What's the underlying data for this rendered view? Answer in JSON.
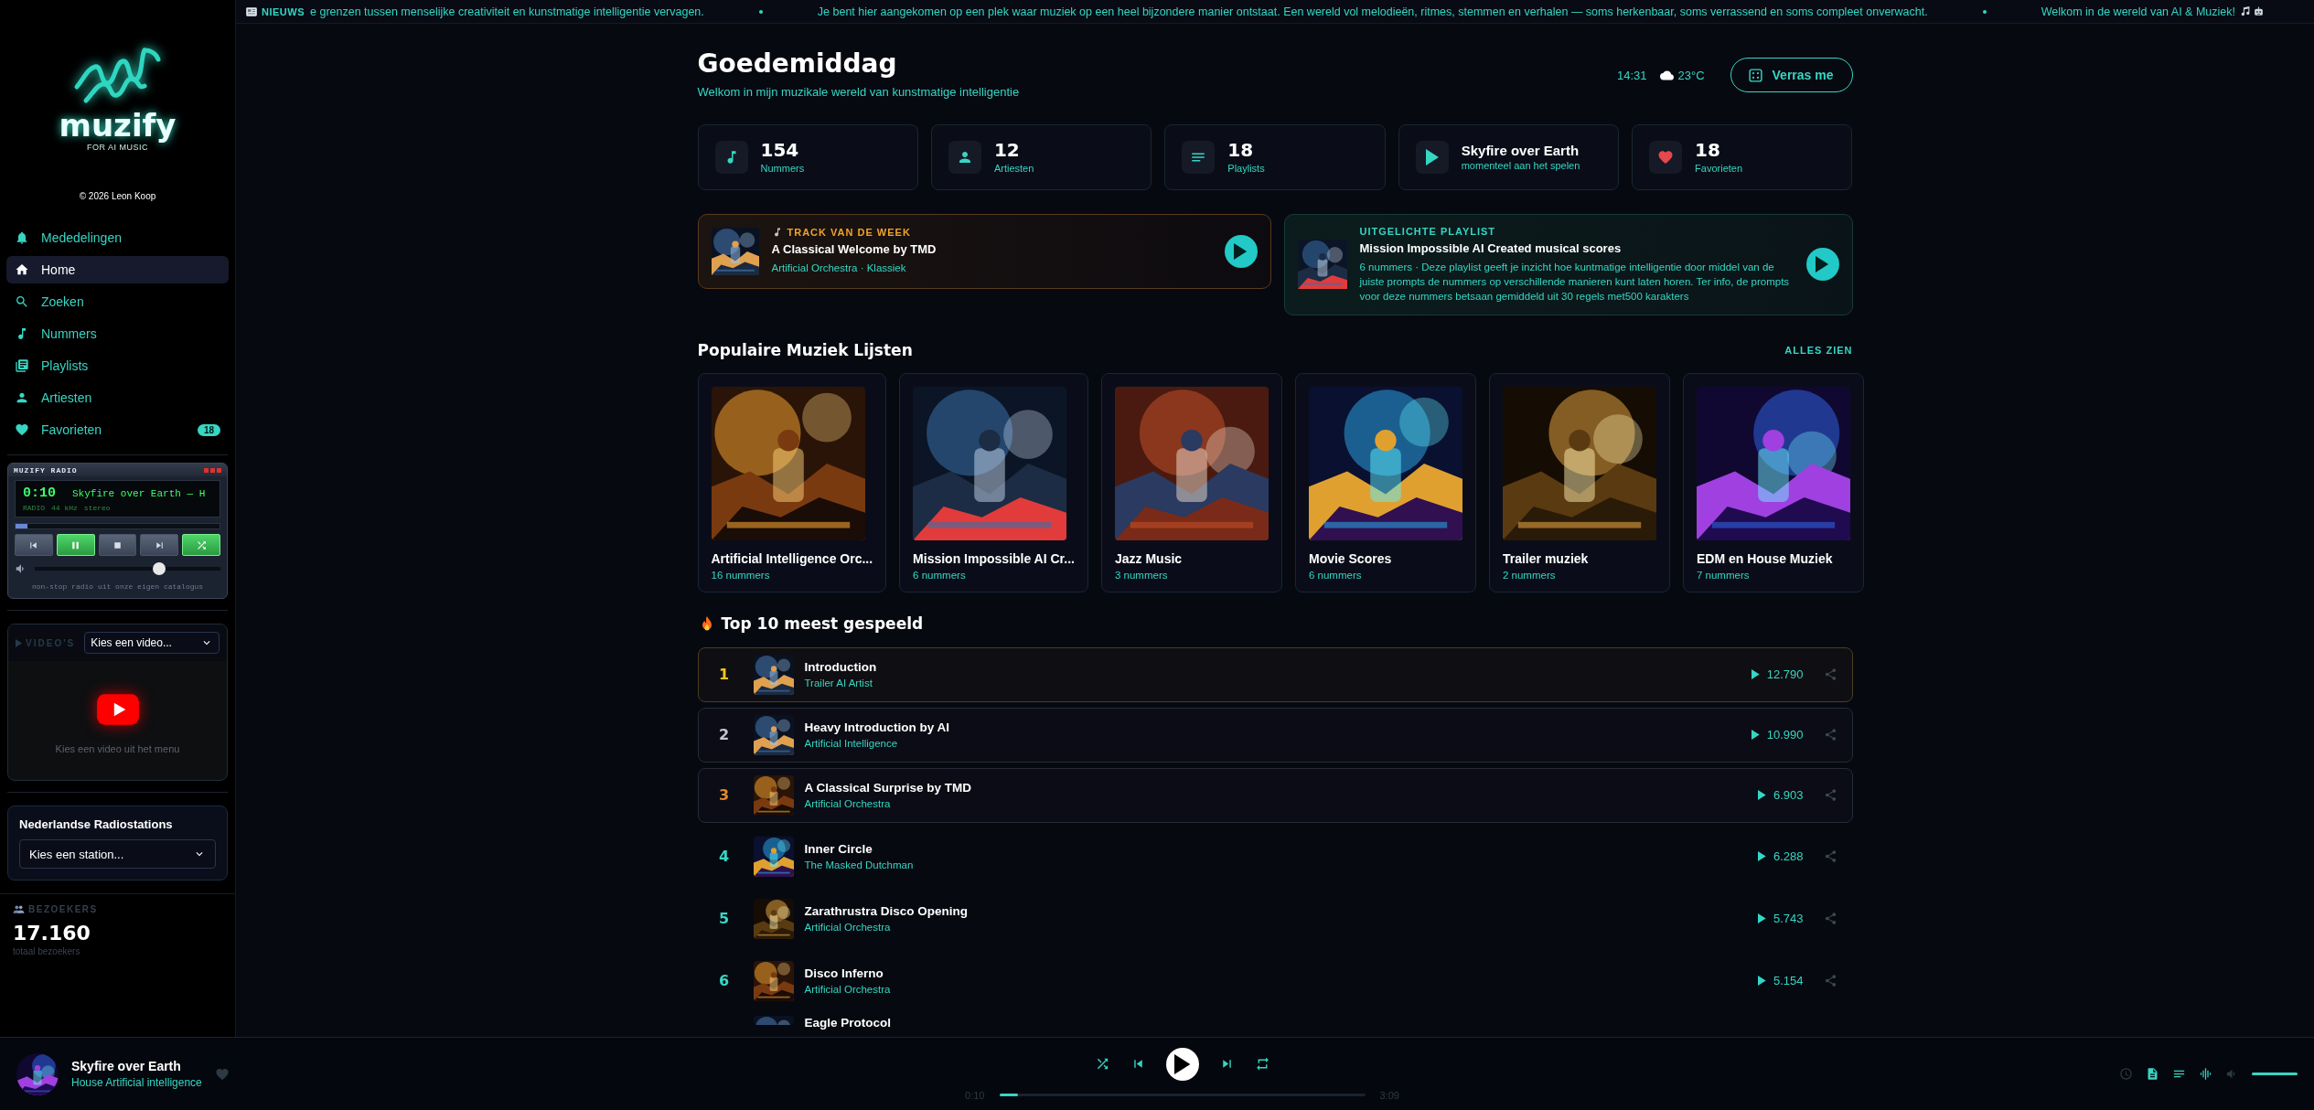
{
  "sidebar": {
    "logo": {
      "name": "muzify",
      "tagline": "FOR AI MUSIC"
    },
    "copyright": "© 2026 Leon Koop",
    "nav": [
      {
        "label": "Mededelingen",
        "kind": "bell",
        "selected": false
      },
      {
        "label": "Home",
        "kind": "home",
        "selected": true
      },
      {
        "label": "Zoeken",
        "kind": "search",
        "selected": false
      },
      {
        "label": "Nummers",
        "kind": "note",
        "selected": false
      },
      {
        "label": "Playlists",
        "kind": "library",
        "selected": false
      },
      {
        "label": "Artiesten",
        "kind": "person",
        "selected": false
      },
      {
        "label": "Favorieten",
        "kind": "heart",
        "selected": false,
        "badge": "18"
      }
    ],
    "radio": {
      "title": "MUZIFY RADIO",
      "time": "0:10",
      "track": "Skyfire over Earth — H",
      "info": [
        "RADIO",
        "44 kHz",
        "stereo"
      ],
      "level": 0.06,
      "buttons": [
        {
          "kind": "prev",
          "on": false
        },
        {
          "kind": "pause",
          "on": true
        },
        {
          "kind": "stop",
          "on": false
        },
        {
          "kind": "next",
          "on": false
        },
        {
          "kind": "shuffle",
          "on": true
        }
      ],
      "volume": {
        "level": 0.68
      },
      "caption": "non-stop radio uit onze eigen catalogus"
    },
    "videos": {
      "label": "VIDEO'S",
      "select": "Kies een video...",
      "hint": "Kies een video uit het menu"
    },
    "stations": {
      "title": "Nederlandse Radiostations",
      "select": "Kies een station..."
    },
    "visitors": {
      "label": "BEZOEKERS",
      "count": "17.160",
      "caption": "totaal bezoekers"
    }
  },
  "ticker": {
    "label": "NIEUWS",
    "items": [
      "e grenzen tussen menselijke creativiteit en kunstmatige intelligentie vervagen.",
      "Je bent hier aangekomen op een plek waar muziek op een heel bijzondere manier ontstaat. Een wereld vol melodieën, ritmes, stemmen en verhalen — soms herkenbaar, soms verrassend en soms compleet onverwacht.",
      "Welkom in de wereld van AI & Muziek!"
    ]
  },
  "header": {
    "title": "Goedemiddag",
    "subtitle": "Welkom in mijn muzikale wereld van kunstmatige intelligentie",
    "time": "14:31",
    "weather": "23°C",
    "button": "Verras me"
  },
  "stats": [
    {
      "kind": "note",
      "value": "154",
      "label": "Nummers"
    },
    {
      "kind": "person",
      "value": "12",
      "label": "Artiesten"
    },
    {
      "kind": "list",
      "value": "18",
      "label": "Playlists"
    },
    {
      "kind": "play",
      "value": "Skyfire over Earth",
      "label": "momenteel aan het spelen"
    },
    {
      "kind": "heart",
      "value": "18",
      "label": "Favorieten"
    }
  ],
  "featured": [
    {
      "kind": "track",
      "label": "TRACK VAN DE WEEK",
      "title": "A Classical Welcome by TMD",
      "subtitle": "Artificial Orchestra · Klassiek"
    },
    {
      "kind": "playlist",
      "label": "UITGELICHTE PLAYLIST",
      "title": "Mission Impossible AI Created musical scores",
      "subtitle": "6 nummers · Deze playlist geeft je inzicht hoe kuntmatige intelligentie door middel van de juiste prompts de nummers op verschillende manieren kunt laten horen. Ter info, de prompts voor deze nummers betsaan gemiddeld uit 30 regels met500 karakters"
    }
  ],
  "playlists": {
    "title": "Populaire Muziek Lijsten",
    "link": "ALLES ZIEN",
    "items": [
      {
        "name": "Artificial Intelligence Orc...",
        "count": "16 nummers"
      },
      {
        "name": "Mission Impossible AI Cr...",
        "count": "6 nummers"
      },
      {
        "name": "Jazz Music",
        "count": "3 nummers"
      },
      {
        "name": "Movie Scores",
        "count": "6 nummers"
      },
      {
        "name": "Trailer muziek",
        "count": "2 nummers"
      },
      {
        "name": "EDM en House Muziek",
        "count": "7 nummers"
      }
    ]
  },
  "top": {
    "title": "Top 10 meest gespeeld",
    "rows": [
      {
        "rank": "1",
        "kind": "gold",
        "title": "Introduction",
        "artist": "Trailer AI Artist",
        "plays": "12.790"
      },
      {
        "rank": "2",
        "kind": "silver",
        "title": "Heavy Introduction by AI",
        "artist": "Artificial Intelligence",
        "plays": "10.990"
      },
      {
        "rank": "3",
        "kind": "bronze",
        "title": "A Classical Surprise by TMD",
        "artist": "Artificial Orchestra",
        "plays": "6.903"
      },
      {
        "rank": "4",
        "kind": "normal",
        "title": "Inner Circle",
        "artist": "The Masked Dutchman",
        "plays": "6.288"
      },
      {
        "rank": "5",
        "kind": "normal",
        "title": "Zarathrustra Disco Opening",
        "artist": "Artificial Orchestra",
        "plays": "5.743"
      },
      {
        "rank": "6",
        "kind": "normal",
        "title": "Disco Inferno",
        "artist": "Artificial Orchestra",
        "plays": "5.154"
      },
      {
        "kind": "partial",
        "title": "Eagle Protocol"
      }
    ]
  },
  "player": {
    "title": "Skyfire over Earth",
    "artist": "House Artificial intelligence",
    "elapsed": "0:10",
    "duration": "3:09",
    "level": 0.05,
    "volume": {
      "level": 1
    }
  }
}
